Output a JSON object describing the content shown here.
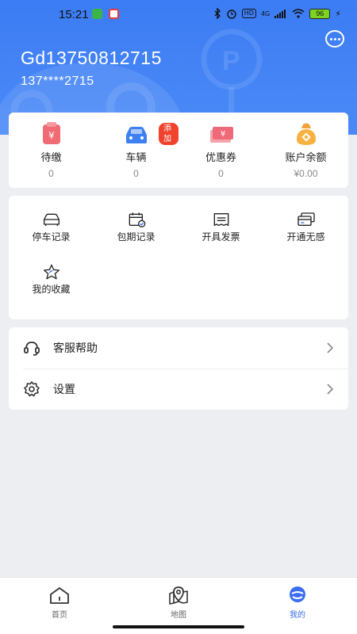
{
  "statusbar": {
    "time": "15:21",
    "network": "4G",
    "hd": "HD",
    "battery": "96"
  },
  "profile": {
    "username": "Gd13750812715",
    "phone": "137****2715"
  },
  "stats": [
    {
      "label": "待缴",
      "value": "0",
      "icon": "unpaid-icon"
    },
    {
      "label": "车辆",
      "value": "0",
      "icon": "car-icon",
      "badge": "添加"
    },
    {
      "label": "优惠券",
      "value": "0",
      "icon": "coupon-icon"
    },
    {
      "label": "账户余额",
      "value": "¥0.00",
      "icon": "money-bag-icon"
    }
  ],
  "tools": [
    {
      "label": "停车记录",
      "icon": "car-outline-icon"
    },
    {
      "label": "包期记录",
      "icon": "calendar-check-icon"
    },
    {
      "label": "开具发票",
      "icon": "invoice-icon"
    },
    {
      "label": "开通无感",
      "icon": "card-icon"
    },
    {
      "label": "我的收藏",
      "icon": "star-icon"
    }
  ],
  "list": [
    {
      "label": "客服帮助",
      "icon": "headset-icon"
    },
    {
      "label": "设置",
      "icon": "gear-icon"
    }
  ],
  "tabs": [
    {
      "label": "首页",
      "icon": "home-icon"
    },
    {
      "label": "地图",
      "icon": "map-pin-icon"
    },
    {
      "label": "我的",
      "icon": "profile-icon",
      "active": true
    }
  ],
  "colors": {
    "header": "#3c7cf4",
    "accent": "#3a6df0",
    "badge": "#f0422d",
    "background": "#eceef2"
  }
}
